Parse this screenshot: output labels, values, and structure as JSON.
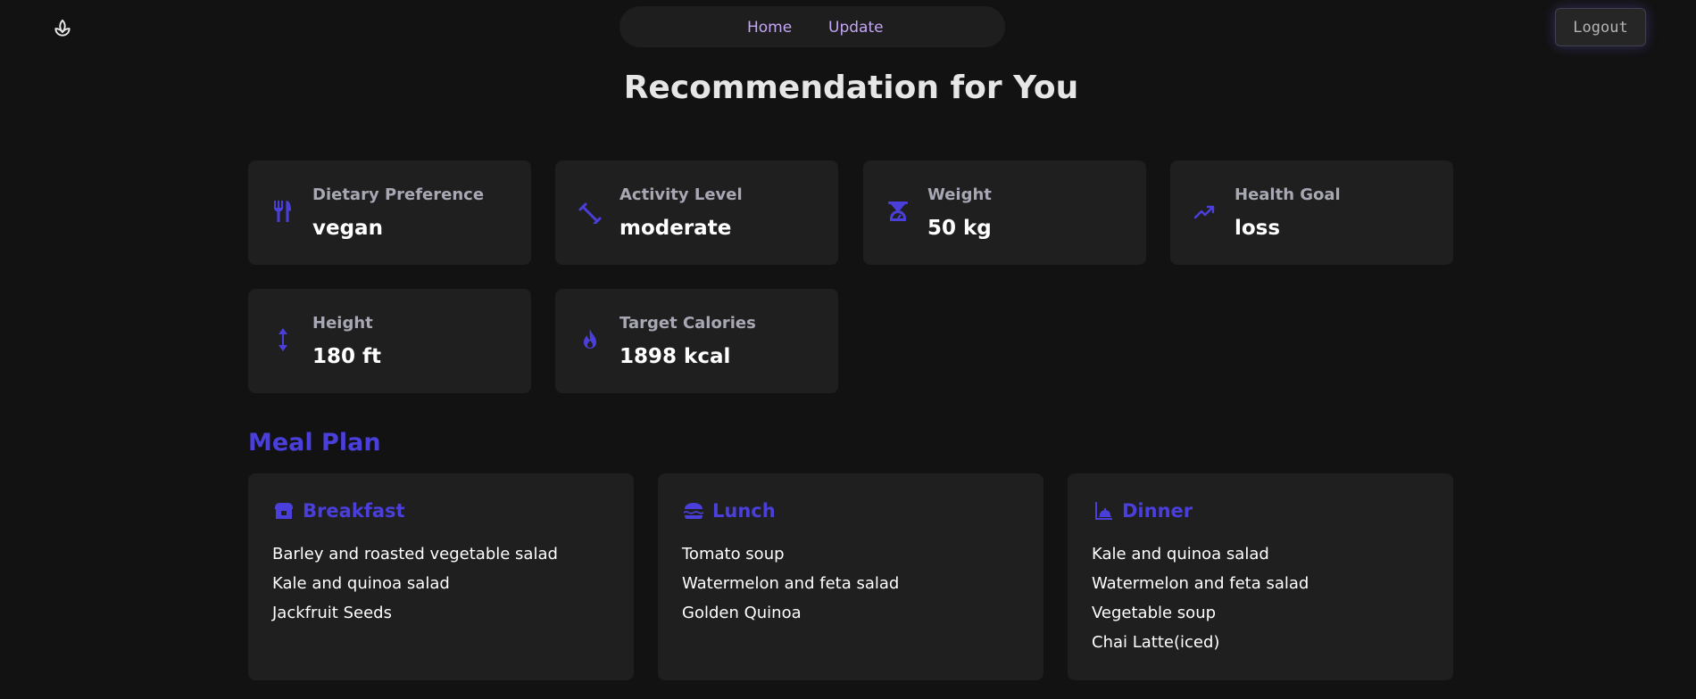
{
  "nav": {
    "logo_icon": "lotus-icon",
    "links": [
      {
        "label": "Home"
      },
      {
        "label": "Update"
      }
    ],
    "logout_label": "Logout"
  },
  "page": {
    "title": "Recommendation for You"
  },
  "stats": [
    {
      "label": "Dietary Preference",
      "value": "vegan",
      "icon": "utensils-icon"
    },
    {
      "label": "Activity Level",
      "value": "moderate",
      "icon": "dumbbell-icon"
    },
    {
      "label": "Weight",
      "value": "50 kg",
      "icon": "weight-scale-icon"
    },
    {
      "label": "Health Goal",
      "value": "loss",
      "icon": "trend-up-icon"
    },
    {
      "label": "Height",
      "value": "180 ft",
      "icon": "vertical-arrows-icon"
    },
    {
      "label": "Target Calories",
      "value": "1898 kcal",
      "icon": "flame-icon"
    }
  ],
  "meal_plan": {
    "title": "Meal Plan",
    "meals": [
      {
        "title": "Breakfast",
        "icon": "toaster-icon",
        "items": [
          "Barley and roasted vegetable salad",
          "Kale and quinoa salad",
          "Jackfruit Seeds"
        ]
      },
      {
        "title": "Lunch",
        "icon": "burger-icon",
        "items": [
          "Tomato soup",
          "Watermelon and feta salad",
          "Golden Quinoa"
        ]
      },
      {
        "title": "Dinner",
        "icon": "plate-icon",
        "items": [
          "Kale and quinoa salad",
          "Watermelon and feta salad",
          "Vegetable soup",
          "Chai Latte(iced)"
        ]
      }
    ]
  },
  "colors": {
    "background": "#121212",
    "card": "#1f1f1f",
    "accent": "#4b3fdc",
    "nav_link": "#c4a6f5",
    "label": "#a8a8b4",
    "text": "#ffffff"
  }
}
